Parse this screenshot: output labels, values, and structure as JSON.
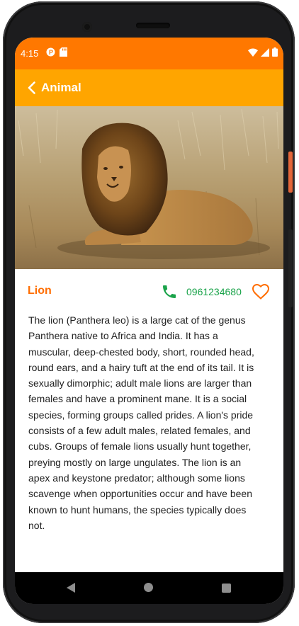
{
  "status_bar": {
    "time": "4:15",
    "left_icons": [
      "data-saver-icon",
      "sd-card-icon"
    ],
    "right_icons": [
      "wifi-icon",
      "signal-icon",
      "battery-icon"
    ]
  },
  "app_bar": {
    "title": "Animal",
    "back_icon": "back-chevron-icon"
  },
  "hero_image": {
    "subject": "lion lying in dry grass"
  },
  "animal": {
    "name": "Lion",
    "phone": "0961234680",
    "favorite": false,
    "description": "The lion (Panthera leo) is a large cat of the genus\nPanthera native to Africa and India. It has a\nmuscular, deep-chested body, short, rounded head,\nround ears, and a hairy tuft at the end of its tail. It is\nsexually dimorphic; adult male lions are larger than\nfemales and have a prominent mane. It is a social\nspecies, forming groups called prides. A lion's pride\nconsists of a few adult males, related females, and\ncubs. Groups of female lions usually hunt together,\npreying mostly on large ungulates. The lion is an\napex and keystone predator; although some lions\nscavenge when opportunities occur and have been\nknown to hunt humans, the species typically does\nnot."
  },
  "nav_bar": {
    "icons": [
      "nav-back-icon",
      "nav-home-icon",
      "nav-recents-icon"
    ]
  },
  "colors": {
    "status_bar": "#ff7800",
    "app_bar": "#ffa500",
    "name": "#ff6d00",
    "phone": "#1aa34a",
    "heart": "#ff6d00"
  }
}
